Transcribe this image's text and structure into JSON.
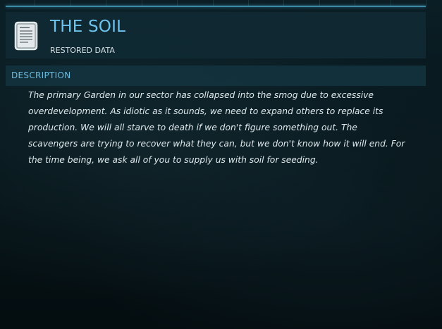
{
  "header": {
    "title": "THE SOIL",
    "subtitle": "RESTORED DATA",
    "icon": "data-note-icon"
  },
  "section": {
    "label": "DESCRIPTION"
  },
  "description": {
    "text": "The primary Garden in our sector has collapsed into the smog due to excessive overdevelopment. As idiotic as it sounds, we need to expand others to replace its production. We will all starve to death if we don't figure something out. The scavengers are trying to recover what they can, but we don't know how it will end. For the time being, we ask all of you to supply us with soil for seeding."
  },
  "colors": {
    "accent": "#6ec4ee",
    "panel": "#102a34",
    "text": "#dfe9ec"
  }
}
